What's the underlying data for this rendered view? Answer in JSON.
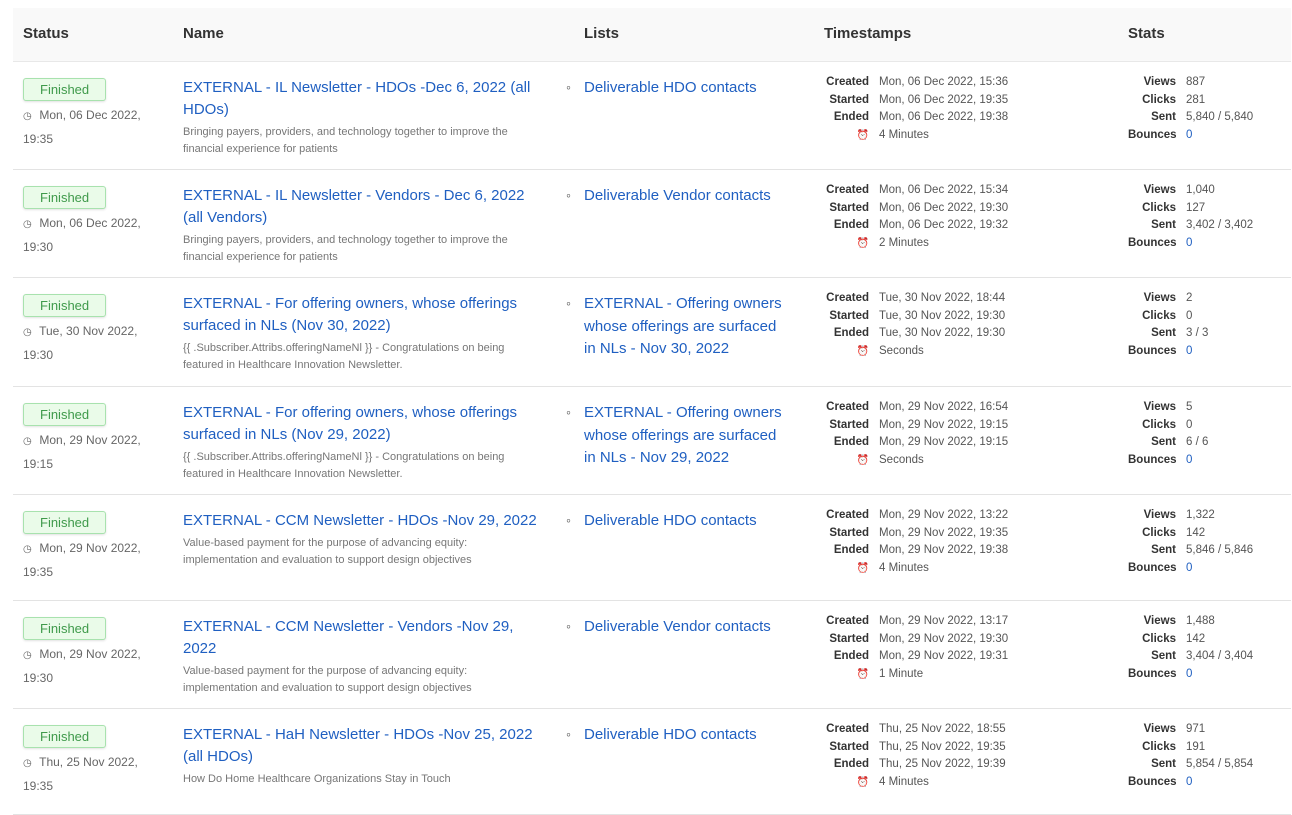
{
  "headers": {
    "status": "Status",
    "name": "Name",
    "lists": "Lists",
    "timestamps": "Timestamps",
    "stats": "Stats"
  },
  "labels": {
    "created": "Created",
    "started": "Started",
    "ended": "Ended",
    "views": "Views",
    "clicks": "Clicks",
    "sent": "Sent",
    "bounces": "Bounces"
  },
  "rows": [
    {
      "status": "Finished",
      "status_date": "Mon, 06 Dec 2022,",
      "status_time": "19:35",
      "name_l1": "EXTERNAL - IL Newsletter - HDOs -Dec 6, 2022 (all",
      "name_l2": "HDOs)",
      "name_l3": "",
      "desc_l1": "Bringing payers, providers, and technology together to improve the",
      "desc_l2": "financial experience for patients",
      "list_l1": "Deliverable HDO contacts",
      "list_l2": "",
      "list_l3": "",
      "created": "Mon, 06 Dec 2022, 15:36",
      "started": "Mon, 06 Dec 2022, 19:35",
      "ended": "Mon, 06 Dec 2022, 19:38",
      "duration": "4 Minutes",
      "views": "887",
      "clicks": "281",
      "sent": "5,840 / 5,840",
      "bounces": "0"
    },
    {
      "status": "Finished",
      "status_date": "Mon, 06 Dec 2022,",
      "status_time": "19:30",
      "name_l1": "EXTERNAL - IL Newsletter - Vendors - Dec 6, 2022",
      "name_l2": "(all Vendors)",
      "name_l3": "",
      "desc_l1": "Bringing payers, providers, and technology together to improve the",
      "desc_l2": "financial experience for patients",
      "list_l1": "Deliverable Vendor contacts",
      "list_l2": "",
      "list_l3": "",
      "created": "Mon, 06 Dec 2022, 15:34",
      "started": "Mon, 06 Dec 2022, 19:30",
      "ended": "Mon, 06 Dec 2022, 19:32",
      "duration": "2 Minutes",
      "views": "1,040",
      "clicks": "127",
      "sent": "3,402 / 3,402",
      "bounces": "0"
    },
    {
      "status": "Finished",
      "status_date": "Tue, 30 Nov 2022,",
      "status_time": "19:30",
      "name_l1": "EXTERNAL - For offering owners, whose offerings",
      "name_l2": "surfaced in NLs (Nov 30, 2022)",
      "name_l3": "",
      "desc_l1": "{{ .Subscriber.Attribs.offeringNameNl }} - Congratulations on being",
      "desc_l2": "featured in Healthcare Innovation Newsletter.",
      "list_l1": "EXTERNAL - Offering owners",
      "list_l2": "whose offerings are surfaced",
      "list_l3": "in NLs - Nov 30, 2022",
      "created": "Tue, 30 Nov 2022, 18:44",
      "started": "Tue, 30 Nov 2022, 19:30",
      "ended": "Tue, 30 Nov 2022, 19:30",
      "duration": "Seconds",
      "views": "2",
      "clicks": "0",
      "sent": "3 / 3",
      "bounces": "0"
    },
    {
      "status": "Finished",
      "status_date": "Mon, 29 Nov 2022,",
      "status_time": "19:15",
      "name_l1": "EXTERNAL - For offering owners, whose offerings",
      "name_l2": "surfaced in NLs (Nov 29, 2022)",
      "name_l3": "",
      "desc_l1": "{{ .Subscriber.Attribs.offeringNameNl }} - Congratulations on being",
      "desc_l2": "featured in Healthcare Innovation Newsletter.",
      "list_l1": "EXTERNAL - Offering owners",
      "list_l2": "whose offerings are surfaced",
      "list_l3": "in NLs - Nov 29, 2022",
      "created": "Mon, 29 Nov 2022, 16:54",
      "started": "Mon, 29 Nov 2022, 19:15",
      "ended": "Mon, 29 Nov 2022, 19:15",
      "duration": "Seconds",
      "views": "5",
      "clicks": "0",
      "sent": "6 / 6",
      "bounces": "0"
    },
    {
      "status": "Finished",
      "status_date": "Mon, 29 Nov 2022,",
      "status_time": "19:35",
      "name_l1": "EXTERNAL - CCM Newsletter - HDOs -Nov 29, 2022",
      "name_l2": "",
      "name_l3": "",
      "desc_l1": "Value-based payment for the purpose of advancing equity:",
      "desc_l2": "implementation and evaluation to support design objectives",
      "list_l1": "Deliverable HDO contacts",
      "list_l2": "",
      "list_l3": "",
      "created": "Mon, 29 Nov 2022, 13:22",
      "started": "Mon, 29 Nov 2022, 19:35",
      "ended": "Mon, 29 Nov 2022, 19:38",
      "duration": "4 Minutes",
      "views": "1,322",
      "clicks": "142",
      "sent": "5,846 / 5,846",
      "bounces": "0"
    },
    {
      "status": "Finished",
      "status_date": "Mon, 29 Nov 2022,",
      "status_time": "19:30",
      "name_l1": "EXTERNAL - CCM Newsletter - Vendors -Nov 29,",
      "name_l2": "2022",
      "name_l3": "",
      "desc_l1": "Value-based payment for the purpose of advancing equity:",
      "desc_l2": "implementation and evaluation to support design objectives",
      "list_l1": "Deliverable Vendor contacts",
      "list_l2": "",
      "list_l3": "",
      "created": "Mon, 29 Nov 2022, 13:17",
      "started": "Mon, 29 Nov 2022, 19:30",
      "ended": "Mon, 29 Nov 2022, 19:31",
      "duration": "1 Minute",
      "views": "1,488",
      "clicks": "142",
      "sent": "3,404 / 3,404",
      "bounces": "0"
    },
    {
      "status": "Finished",
      "status_date": "Thu, 25 Nov 2022,",
      "status_time": "19:35",
      "name_l1": "EXTERNAL - HaH Newsletter - HDOs -Nov 25, 2022",
      "name_l2": "(all HDOs)",
      "name_l3": "",
      "desc_l1": "How Do Home Healthcare Organizations Stay in Touch",
      "desc_l2": "",
      "list_l1": "Deliverable HDO contacts",
      "list_l2": "",
      "list_l3": "",
      "created": "Thu, 25 Nov 2022, 18:55",
      "started": "Thu, 25 Nov 2022, 19:35",
      "ended": "Thu, 25 Nov 2022, 19:39",
      "duration": "4 Minutes",
      "views": "971",
      "clicks": "191",
      "sent": "5,854 / 5,854",
      "bounces": "0"
    }
  ]
}
